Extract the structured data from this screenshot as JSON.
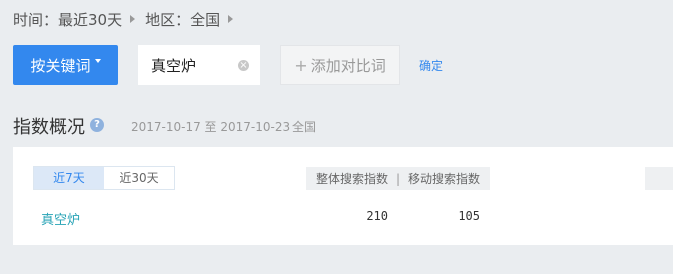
{
  "breadcrumb": {
    "time": "时间：最近30天",
    "region": "地区：全国"
  },
  "search": {
    "keyword_button": "按关键词",
    "term": "真空炉",
    "add_compare": "添加对比词",
    "confirm": "确定"
  },
  "overview": {
    "title": "指数概况",
    "date_range": "2017-10-17 至 2017-10-23",
    "region": "全国",
    "tabs": [
      {
        "label": "近7天",
        "active": true
      },
      {
        "label": "近30天",
        "active": false
      }
    ],
    "headers": {
      "overall": "整体搜索指数",
      "separator": "|",
      "mobile": "移动搜索指数"
    },
    "rows": [
      {
        "term": "真空炉",
        "overall": "210",
        "mobile": "105"
      }
    ]
  },
  "colors": {
    "primary": "#3388ee",
    "term_link": "#27a3b6",
    "background": "#eaedf0"
  }
}
